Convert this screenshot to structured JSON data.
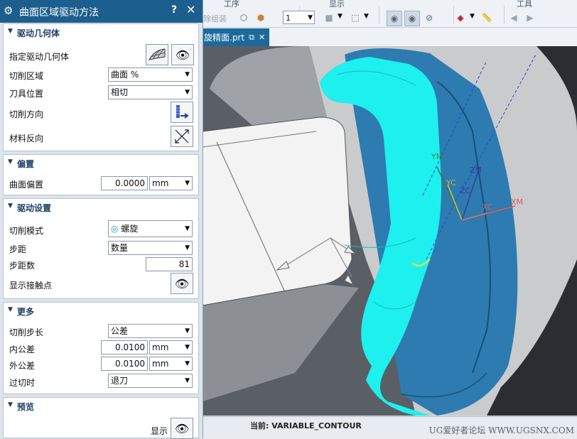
{
  "dialog": {
    "title": "曲面区域驱动方法",
    "help_glyph": "?",
    "close_glyph": "✕",
    "sections": {
      "drive_geometry": {
        "header": "驱动几何体",
        "specify_label": "指定驱动几何体",
        "cut_area_label": "切削区域",
        "cut_area_value": "曲面 %",
        "tool_position_label": "刀具位置",
        "tool_position_value": "相切",
        "cut_direction_label": "切削方向",
        "material_reverse_label": "材料反向"
      },
      "offset": {
        "header": "偏置",
        "surface_offset_label": "曲面偏置",
        "surface_offset_value": "0.0000",
        "unit": "mm"
      },
      "drive_settings": {
        "header": "驱动设置",
        "cut_pattern_label": "切削模式",
        "cut_pattern_value": "螺旋",
        "stepover_label": "步距",
        "stepover_value": "数量",
        "num_steps_label": "步距数",
        "num_steps_value": "81",
        "show_contact_label": "显示接触点"
      },
      "more": {
        "header": "更多",
        "cut_step_label": "切削步长",
        "cut_step_value": "公差",
        "intol_label": "内公差",
        "intol_value": "0.0100",
        "intol_unit": "mm",
        "outtol_label": "外公差",
        "outtol_value": "0.0100",
        "outtol_unit": "mm",
        "overcut_label": "过切时",
        "overcut_value": "退刀"
      },
      "preview": {
        "header": "预览",
        "show_label": "显示"
      }
    }
  },
  "ribbon": {
    "group_process": "工序",
    "group_display": "显示",
    "group_tools": "工具",
    "remove_assembly": "除组装",
    "layer_value": "1"
  },
  "tab": {
    "label": "旋精面.prt"
  },
  "viewport": {
    "axis_labels": {
      "ym": "YM",
      "yc": "YC",
      "zm": "ZM",
      "zc": "ZC",
      "xc": "XC",
      "xm": "XM"
    }
  },
  "status": {
    "current": "当前: VARIABLE_CONTOUR",
    "watermark": "UG爱好者论坛 WWW.UGSNX.COM"
  },
  "colors": {
    "title_bar": "#1c5f8e",
    "toolpath": "#1ef2ef",
    "part_blue": "#2f7fb5",
    "section_header": "#1d3f66"
  }
}
